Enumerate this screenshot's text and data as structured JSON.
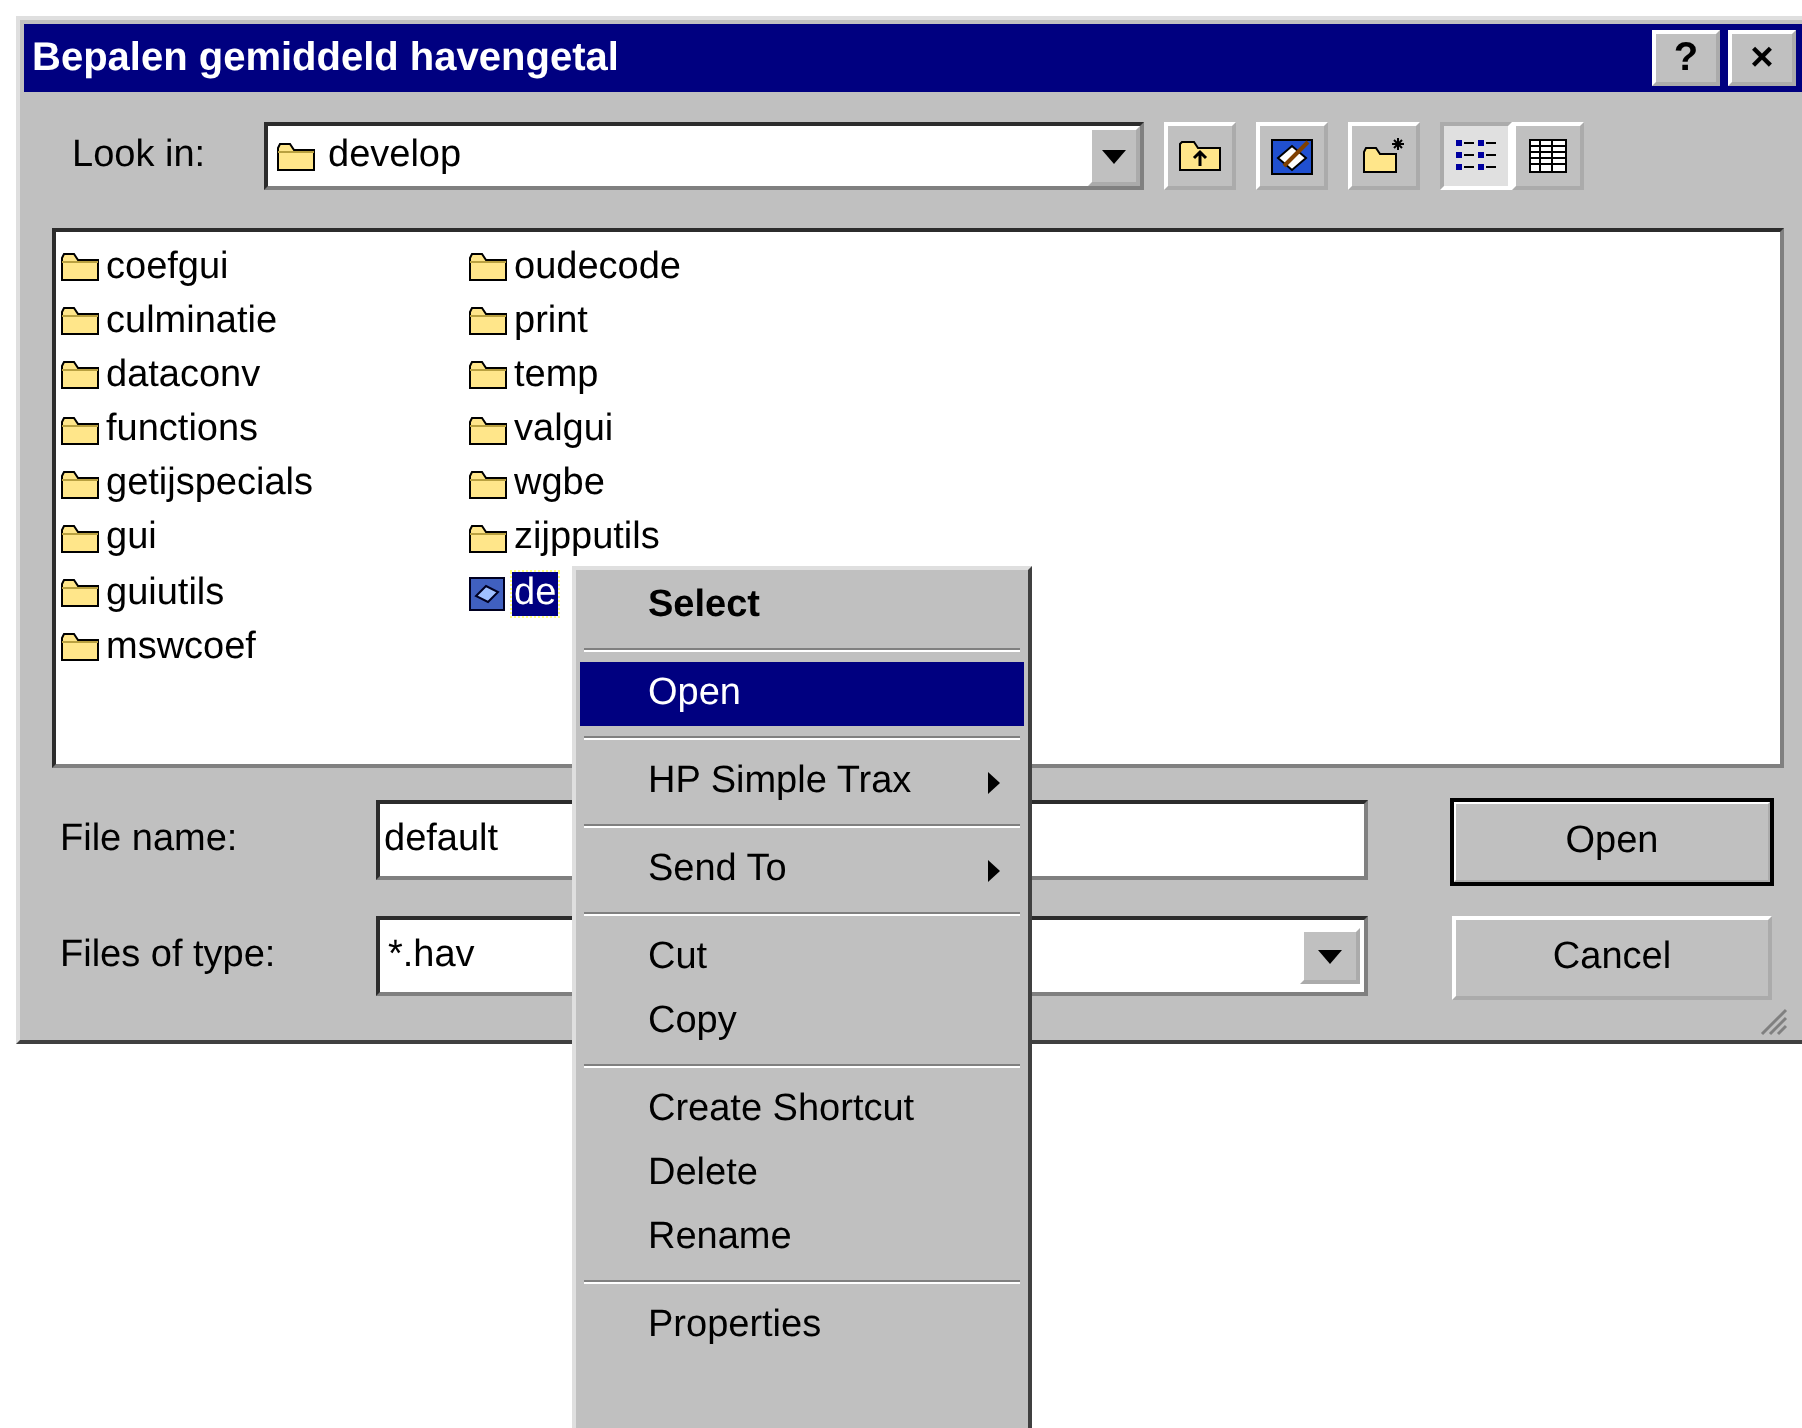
{
  "window": {
    "title": "Bepalen gemiddeld havengetal",
    "title_buttons": [
      "?",
      "×"
    ]
  },
  "look_in": {
    "label": "Look in:",
    "value": "develop"
  },
  "toolbar": [
    {
      "kind": "up-folder",
      "selected": false
    },
    {
      "kind": "desktop",
      "selected": false
    },
    {
      "kind": "new-folder",
      "selected": false
    },
    {
      "kind": "list-view",
      "selected": true
    },
    {
      "kind": "details-view",
      "selected": false
    }
  ],
  "files": [
    {
      "name": "coefgui",
      "kind": "folder",
      "selected": false
    },
    {
      "name": "culminatie",
      "kind": "folder",
      "selected": false
    },
    {
      "name": "dataconv",
      "kind": "folder",
      "selected": false
    },
    {
      "name": "functions",
      "kind": "folder",
      "selected": false
    },
    {
      "name": "getijspecials",
      "kind": "folder",
      "selected": false
    },
    {
      "name": "gui",
      "kind": "folder",
      "selected": false
    },
    {
      "name": "guiutils",
      "kind": "folder",
      "selected": false
    },
    {
      "name": "mswcoef",
      "kind": "folder",
      "selected": false
    },
    {
      "name": "oudecode",
      "kind": "folder",
      "selected": false
    },
    {
      "name": "print",
      "kind": "folder",
      "selected": false
    },
    {
      "name": "temp",
      "kind": "folder",
      "selected": false
    },
    {
      "name": "valgui",
      "kind": "folder",
      "selected": false
    },
    {
      "name": "wgbe",
      "kind": "folder",
      "selected": false
    },
    {
      "name": "zijpputils",
      "kind": "folder",
      "selected": false
    },
    {
      "name": "de",
      "kind": "file",
      "selected": true
    }
  ],
  "file_name": {
    "label": "File name:",
    "value": "default"
  },
  "file_type": {
    "label": "Files of type:",
    "value": "*.hav"
  },
  "buttons": [
    {
      "label": "Open",
      "default": true
    },
    {
      "label": "Cancel",
      "default": false
    }
  ],
  "context_menu": [
    {
      "kind": "item",
      "label": "Select",
      "default": true,
      "selected": false,
      "submenu": false
    },
    {
      "kind": "separator"
    },
    {
      "kind": "item",
      "label": "Open",
      "default": false,
      "selected": true,
      "submenu": false
    },
    {
      "kind": "separator"
    },
    {
      "kind": "item",
      "label": "HP Simple Trax",
      "default": false,
      "selected": false,
      "submenu": true
    },
    {
      "kind": "separator"
    },
    {
      "kind": "item",
      "label": "Send To",
      "default": false,
      "selected": false,
      "submenu": true
    },
    {
      "kind": "separator"
    },
    {
      "kind": "item",
      "label": "Cut",
      "default": false,
      "selected": false,
      "submenu": false
    },
    {
      "kind": "item",
      "label": "Copy",
      "default": false,
      "selected": false,
      "submenu": false
    },
    {
      "kind": "separator"
    },
    {
      "kind": "item",
      "label": "Create Shortcut",
      "default": false,
      "selected": false,
      "submenu": false
    },
    {
      "kind": "item",
      "label": "Delete",
      "default": false,
      "selected": false,
      "submenu": false
    },
    {
      "kind": "item",
      "label": "Rename",
      "default": false,
      "selected": false,
      "submenu": false
    },
    {
      "kind": "separator"
    },
    {
      "kind": "item",
      "label": "Properties",
      "default": false,
      "selected": false,
      "submenu": false
    }
  ]
}
